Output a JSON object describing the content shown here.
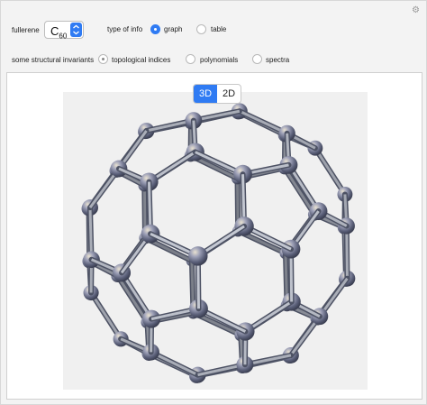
{
  "controls": {
    "fullerene_label": "fullerene",
    "fullerene_value": "C",
    "fullerene_sub": "60",
    "type_label": "type of info",
    "type_options": [
      "graph",
      "table"
    ],
    "type_selected": "graph",
    "invariants_label": "some structural invariants",
    "invariant_options": [
      "topological indices",
      "polynomials",
      "spectra"
    ]
  },
  "view_toggle": {
    "options": [
      "3D",
      "2D"
    ],
    "selected": "3D"
  },
  "icons": {
    "settings": "gear-icon",
    "stepper": "up-down-chevron-icon"
  },
  "colors": {
    "accent": "#2f7bf3",
    "atom": "#7a7f99",
    "bond": "#8a909e"
  }
}
